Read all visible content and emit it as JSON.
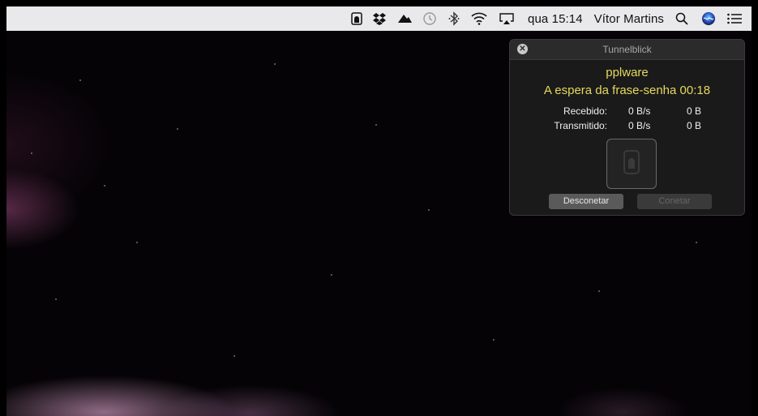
{
  "menubar": {
    "icons": [
      "tunnelblick-icon",
      "dropbox-icon",
      "cloud-icon",
      "time-machine-icon",
      "bluetooth-icon",
      "wifi-icon",
      "airplay-icon"
    ],
    "clock": "qua 15:14",
    "user": "Vítor Martins",
    "right_icons": [
      "search-icon",
      "siri-icon",
      "notification-center-icon"
    ]
  },
  "panel": {
    "title": "Tunnelblick",
    "connection_name": "pplware",
    "status": "A espera da frase-senha 00:18",
    "stats": [
      {
        "label": "Recebido:",
        "rate": "0 B/s",
        "total": "0 B"
      },
      {
        "label": "Transmitido:",
        "rate": "0 B/s",
        "total": "0 B"
      }
    ],
    "disconnect_label": "Desconetar",
    "connect_label": "Conetar"
  },
  "colors": {
    "status_yellow": "#e6d95a",
    "menubar_bg": "#e9e8ea",
    "panel_bg": "#1c1c1c"
  }
}
